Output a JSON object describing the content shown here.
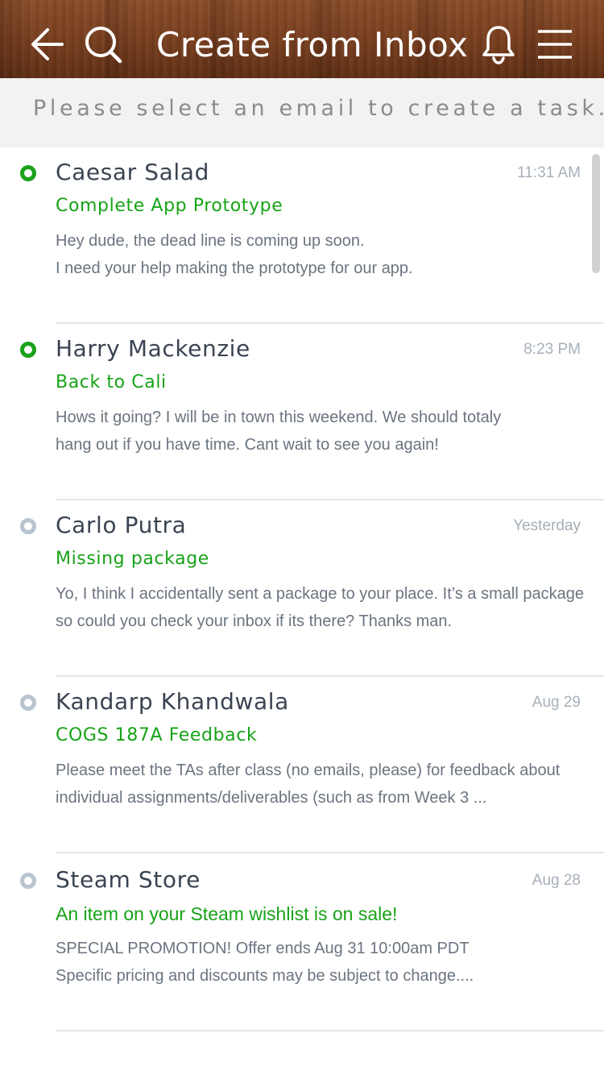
{
  "header": {
    "title": "Create from Inbox",
    "back_icon": "back-arrow-icon",
    "search_icon": "search-icon",
    "bell_icon": "bell-icon",
    "menu_icon": "hamburger-menu-icon"
  },
  "instruction": "Please select an email to create a task.",
  "colors": {
    "accent_green": "#17a317",
    "unread_dot": "#1aa21a",
    "read_dot": "#b9c4d0"
  },
  "emails": [
    {
      "sender": "Caesar Salad",
      "time": "11:31 AM",
      "subject": "Complete App Prototype",
      "preview_line1": "Hey dude,  the dead line is coming up soon.",
      "preview_line2": "I need your help making the prototype for our app.",
      "unread": true
    },
    {
      "sender": "Harry Mackenzie",
      "time": "8:23 PM",
      "subject": "Back to Cali",
      "preview_line1": "Hows it going? I will be in town this weekend. We should totaly",
      "preview_line2": "hang out if you have time. Cant wait to see you again!",
      "unread": true
    },
    {
      "sender": "Carlo Putra",
      "time": "Yesterday",
      "subject": "Missing package",
      "preview_line1": "Yo, I think I accidentally sent a package to your place. It’s a small package",
      "preview_line2": "so could you check your inbox if its there?  Thanks man.",
      "unread": false
    },
    {
      "sender": "Kandarp Khandwala",
      "time": "Aug 29",
      "subject": "COGS 187A Feedback",
      "preview_line1": "Please meet the TAs after class (no emails, please) for feedback about",
      "preview_line2": "individual assignments/deliverables (such as from Week 3 ...",
      "unread": false
    },
    {
      "sender": "Steam Store",
      "time": "Aug  28",
      "subject": "An item on your Steam wishlist is on sale!",
      "preview_line1": "SPECIAL PROMOTION! Offer ends Aug 31 10:00am PDT",
      "preview_line2": "Specific pricing and discounts may be subject to change....",
      "unread": false
    }
  ]
}
